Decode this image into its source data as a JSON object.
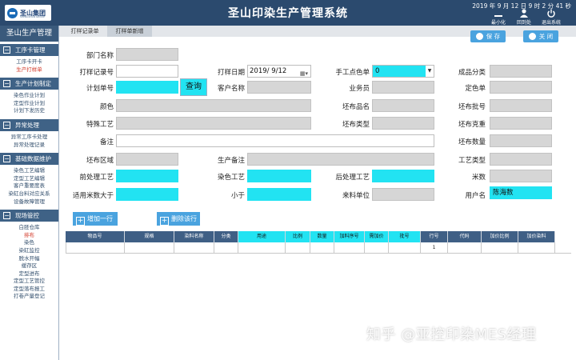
{
  "header": {
    "logo_text": "圣山集团",
    "logo_sub": "SHENGSHAN GROUP",
    "title": "圣山印染生产管理系统",
    "datetime": "2019 年 9 月 12 日  9 时 2 分 41 秒",
    "buttons": {
      "minimize": "最小化",
      "back": "回到处",
      "exit": "退出系统"
    }
  },
  "sidebar": {
    "title": "圣山生产管理",
    "groups": [
      {
        "label": "工序卡管理",
        "items": [
          "工序卡开卡",
          "生产打样单"
        ]
      },
      {
        "label": "生产计划制定",
        "items": [
          "染色作业计划",
          "定型作业计划",
          "计划下发历史"
        ]
      },
      {
        "label": "异常处理",
        "items": [
          "异常工序卡处理",
          "异常处理记录"
        ]
      },
      {
        "label": "基础数据维护",
        "items": [
          "染色工艺编辑",
          "定型工艺编辑",
          "客户重要度表",
          "染缸台料对应关系",
          "设备故障管理"
        ]
      },
      {
        "label": "现场管控",
        "items": [
          "白胚仓库",
          "排布",
          "染色",
          "染缸监控",
          "脱水开幅",
          "缓存区",
          "定型进布",
          "定型工艺管控",
          "定型落布报工",
          "打卷产量登记"
        ]
      }
    ],
    "active_item": "生产打样单",
    "active_item2": "排布"
  },
  "tabs": [
    "打样记录单",
    "打样单新增"
  ],
  "actions": {
    "save": "保 存",
    "close": "关 闭"
  },
  "form": {
    "dept": {
      "label": "部门名称",
      "value": ""
    },
    "record_no": {
      "label": "打样记录号",
      "value": ""
    },
    "sample_date": {
      "label": "打样日期",
      "value": "2019/ 9/12"
    },
    "manual_spot": {
      "label": "手工点色单",
      "value": "0"
    },
    "product_class": {
      "label": "成品分类",
      "value": ""
    },
    "plan_no": {
      "label": "计划单号",
      "value": ""
    },
    "query_btn": "查询",
    "customer": {
      "label": "客户名称",
      "value": ""
    },
    "salesman": {
      "label": "业务员",
      "value": ""
    },
    "color_order": {
      "label": "定色单",
      "value": ""
    },
    "color": {
      "label": "颜色",
      "value": ""
    },
    "greige_name": {
      "label": "坯布品名",
      "value": ""
    },
    "greige_batch": {
      "label": "坯布批号",
      "value": ""
    },
    "special": {
      "label": "特殊工艺",
      "value": ""
    },
    "greige_type": {
      "label": "坯布类型",
      "value": ""
    },
    "greige_weight": {
      "label": "坯布克重",
      "value": ""
    },
    "remark": {
      "label": "备注",
      "value": ""
    },
    "greige_qty": {
      "label": "坯布数量",
      "value": ""
    },
    "area": {
      "label": "坯布区域",
      "value": ""
    },
    "prod_remark": {
      "label": "生产备注",
      "value": ""
    },
    "craft_type": {
      "label": "工艺类型",
      "value": ""
    },
    "pre_craft": {
      "label": "前处理工艺",
      "value": ""
    },
    "dye_craft": {
      "label": "染色工艺",
      "value": ""
    },
    "post_craft": {
      "label": "后处理工艺",
      "value": ""
    },
    "meters": {
      "label": "米数",
      "value": ""
    },
    "meters_gt": {
      "label": "适用米数大于",
      "value": ""
    },
    "lt": {
      "label": "小于",
      "value": ""
    },
    "unit": {
      "label": "来料单位",
      "value": ""
    },
    "user": {
      "label": "用户名",
      "value": "陈海数"
    }
  },
  "table_buttons": {
    "add": "增加一行",
    "delete": "删除该行"
  },
  "table": {
    "headers": [
      "物品号",
      "规格",
      "染料名称",
      "分类",
      "用途",
      "比例",
      "数量",
      "加料序号",
      "需加价",
      "批号",
      "行号",
      "代码",
      "加价比例",
      "加价染料"
    ],
    "rows": [
      [
        "",
        "",
        "",
        "",
        "",
        "",
        "",
        "",
        "",
        "",
        "1",
        "",
        "",
        ""
      ]
    ]
  },
  "watermark": "知乎 @亚控印染MES经理"
}
